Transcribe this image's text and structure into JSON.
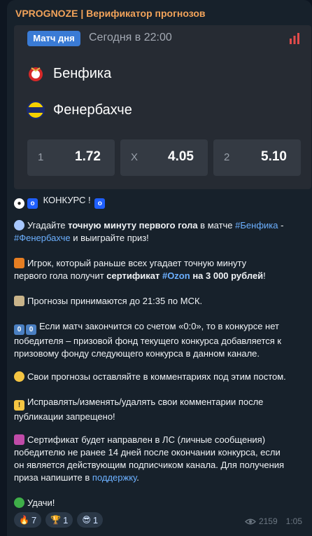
{
  "channel_title": "VPROGNOZE | Верификатор прогнозов",
  "match": {
    "badge": "Матч дня",
    "when": "Сегодня в 22:00",
    "home": "Бенфика",
    "away": "Фенербахче",
    "odds": [
      {
        "label": "1",
        "value": "1.72"
      },
      {
        "label": "X",
        "value": "4.05"
      },
      {
        "label": "2",
        "value": "5.10"
      }
    ]
  },
  "post": {
    "l1": "КОНКУРС !",
    "l2_a": "Угадайте ",
    "l2_b": "точную минуту первого гола",
    "l2_c": " в матче ",
    "l2_tag1": "#Бенфика",
    "l2_d": " -",
    "l2_tag2": "#Фенербахче",
    "l2_e": " и выиграйте  приз!",
    "l3_a": "Игрок, который раньше всех угадает точную минуту",
    "l3_b": "первого гола получит ",
    "l3_c": "сертификат ",
    "l3_tag": "#Ozon",
    "l3_d": " на 3 000 рублей",
    "l3_e": "!",
    "l4": "Прогнозы принимаются до 21:35 по МСК.",
    "l5_a": "Если матч закончится со счетом «0:0», то в конкурсе нет",
    "l5_b": "победителя – призовой фонд текущего конкурса добавляется к",
    "l5_c": "призовому фонду следующего конкурса в данном канале.",
    "l6": "Свои прогнозы оставляйте  в комментариях под этим постом.",
    "l7_a": "Исправлять/изменять/удалять свои комментарии после",
    "l7_b": "публикации запрещено!",
    "l8_a": "Сертификат будет направлен в ЛС (личные сообщения)",
    "l8_b": "победителю не ранее 14 дней после окончании конкурса, если",
    "l8_c": "он является действующим подписчиком канала. Для получения",
    "l8_d": "приза напишите в ",
    "l8_link": "поддержку",
    "l8_e": ".",
    "l9": "Удачи!"
  },
  "emoji": {
    "zero": "0"
  },
  "reactions": [
    {
      "icon": "fire-icon",
      "glyph": "🔥",
      "count": "7"
    },
    {
      "icon": "trophy-icon",
      "glyph": "🏆",
      "count": "1"
    },
    {
      "icon": "cool-face-icon",
      "glyph": "😎",
      "count": "1"
    }
  ],
  "views": "2159",
  "time": "1:05"
}
